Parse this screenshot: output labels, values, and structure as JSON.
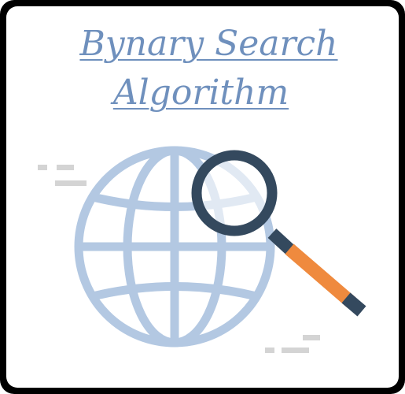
{
  "title": {
    "line1": "Bynary Search",
    "line2": "Algorithm"
  },
  "illustration": {
    "icons": [
      "globe-icon",
      "magnifying-glass-icon"
    ]
  },
  "colors": {
    "globe": "#b3c8e2",
    "lens": "#34495e",
    "handle": "#ef8a3e",
    "text": "#6f90bd",
    "dash": "#d2d2d2"
  }
}
